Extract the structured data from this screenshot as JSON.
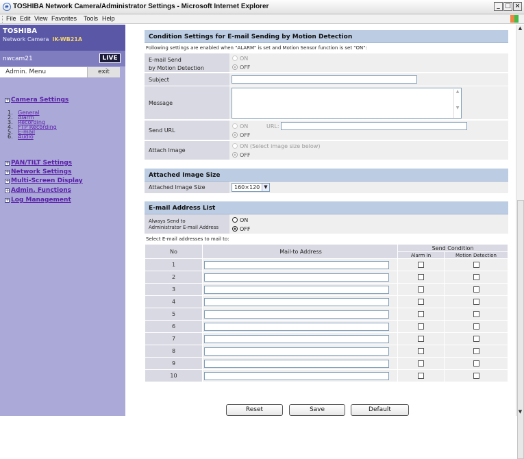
{
  "window": {
    "title": "TOSHIBA Network Camera/Administrator Settings - Microsoft Internet Explorer",
    "buttons": [
      "_",
      "□",
      "×"
    ]
  },
  "menu": [
    "File",
    "Edit",
    "View",
    "Favorites",
    "Tools",
    "Help"
  ],
  "sidebar": {
    "brand": "TOSHIBA",
    "model_prefix": "Network Camera",
    "model": "IK-WB21A",
    "camera_name": "nwcam21",
    "live": "LIVE",
    "admin_menu": "Admin. Menu",
    "exit": "exit",
    "camera_settings": "Camera Settings",
    "sub": [
      {
        "num": "1.",
        "label": "General"
      },
      {
        "num": "2.",
        "label": "Alarm"
      },
      {
        "num": "3.",
        "label": "Recording"
      },
      {
        "num": "4.",
        "label": "FTP Recording"
      },
      {
        "num": "5.",
        "label": "E-mail"
      },
      {
        "num": "6.",
        "label": "Audio"
      }
    ],
    "pan_tilt": "PAN/TILT Settings",
    "network": "Network Settings",
    "multiscreen": "Multi-Screen Display",
    "admin_functions": "Admin. Functions",
    "log": "Log Management"
  },
  "section1": {
    "title": "Condition Settings for E-mail Sending by Motion Detection",
    "note": "Following settings are enabled when \"ALARM\" is set and Motion Sensor function is set \"ON\":",
    "email_send": {
      "label1": "E-mail Send",
      "label2": "by Motion Detection",
      "on": "ON",
      "off": "OFF"
    },
    "subject": {
      "label": "Subject",
      "value": ""
    },
    "message": {
      "label": "Message",
      "value": ""
    },
    "send_url": {
      "label": "Send URL",
      "on": "ON",
      "url_label": "URL:",
      "url_value": "",
      "off": "OFF"
    },
    "attach_image": {
      "label": "Attach Image",
      "on": "ON (Select image size below)",
      "off": "OFF"
    }
  },
  "section2": {
    "title": "Attached Image Size",
    "label": "Attached Image Size",
    "value": "160×120"
  },
  "section3": {
    "title": "E-mail Address List",
    "always_label1": "Always Send to",
    "always_label2": "Administrator E-mail Address",
    "always_on": "ON",
    "always_off": "OFF",
    "select_note": "Select E-mail addresses to mail to:",
    "col_no": "No",
    "col_address": "Mail-to Address",
    "col_send": "Send Condition",
    "col_alarm": "Alarm In",
    "col_motion": "Motion Detection",
    "rows": [
      "1",
      "2",
      "3",
      "4",
      "5",
      "6",
      "7",
      "8",
      "9",
      "10"
    ]
  },
  "buttons": {
    "reset": "Reset",
    "save": "Save",
    "default": "Default"
  }
}
